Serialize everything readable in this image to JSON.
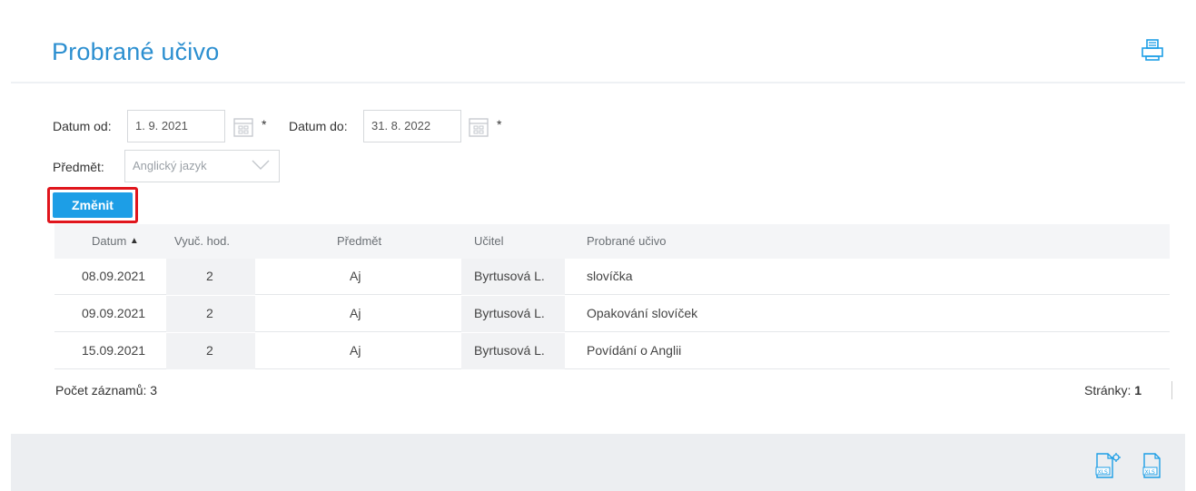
{
  "header": {
    "title": "Probrané učivo",
    "print_icon": "printer-icon"
  },
  "filters": {
    "date_from_label": "Datum od:",
    "date_from_value": "1. 9. 2021",
    "date_to_label": "Datum do:",
    "date_to_value": "31. 8. 2022",
    "required_mark": "*",
    "subject_label": "Předmět:",
    "subject_value": "Anglický jazyk",
    "submit_label": "Změnit"
  },
  "table": {
    "columns": [
      "Datum",
      "Vyuč. hod.",
      "Předmět",
      "Učitel",
      "Probrané učivo"
    ],
    "sort_indicator": "▲",
    "rows": [
      {
        "date": "08.09.2021",
        "hours": "2",
        "subject": "Aj",
        "teacher": "Byrtusová L.",
        "topic": "slovíčka"
      },
      {
        "date": "09.09.2021",
        "hours": "2",
        "subject": "Aj",
        "teacher": "Byrtusová L.",
        "topic": "Opakování slovíček"
      },
      {
        "date": "15.09.2021",
        "hours": "2",
        "subject": "Aj",
        "teacher": "Byrtusová L.",
        "topic": "Povídání o Anglii"
      }
    ]
  },
  "footer": {
    "count_label": "Počet záznamů: 3",
    "pages_label": "Stránky:",
    "current_page": "1"
  },
  "colors": {
    "accent": "#1d9ee6",
    "title": "#2c8fd0",
    "highlight": "#e0151c"
  }
}
